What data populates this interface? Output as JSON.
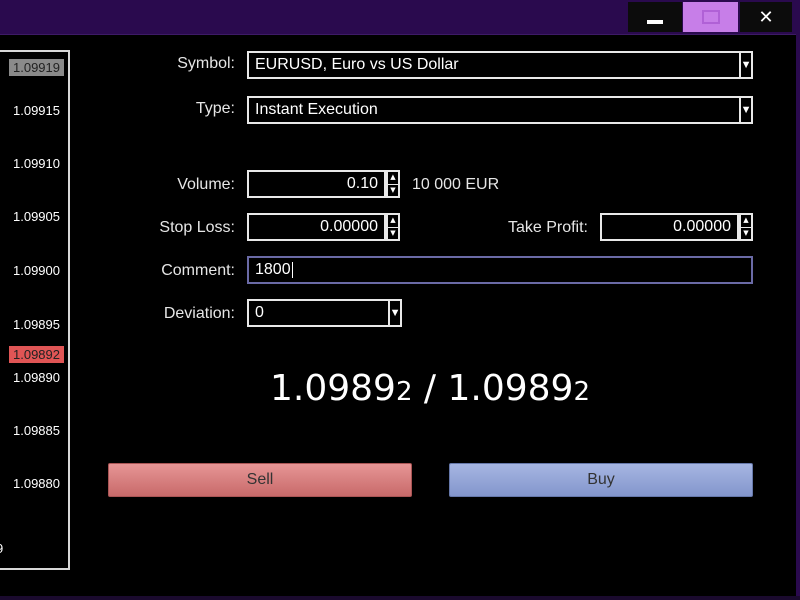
{
  "window": {
    "close_glyph": "✕",
    "min_icon": "minimize-icon",
    "max_icon": "maximize-icon"
  },
  "ticks": {
    "boxed_top": "1.09919",
    "levels": [
      "1.09915",
      "1.09910",
      "1.09905",
      "1.09900",
      "1.09895"
    ],
    "current": "1.09892",
    "lower": [
      "1.09890",
      "1.09885",
      "1.09880"
    ],
    "cut_off": "9"
  },
  "form": {
    "symbol_label": "Symbol:",
    "symbol_value": "EURUSD, Euro vs US Dollar",
    "type_label": "Type:",
    "type_value": "Instant Execution",
    "volume_label": "Volume:",
    "volume_value": "0.10",
    "volume_note": "10 000 EUR",
    "stoploss_label": "Stop Loss:",
    "stoploss_value": "0.00000",
    "takeprofit_label": "Take Profit:",
    "takeprofit_value": "0.00000",
    "comment_label": "Comment:",
    "comment_value": "1800",
    "deviation_label": "Deviation:",
    "deviation_value": "0"
  },
  "quote": {
    "bid_main": "1.0989",
    "bid_small": "2",
    "separator": " / ",
    "ask_main": "1.0989",
    "ask_small": "2"
  },
  "buttons": {
    "sell": "Sell",
    "buy": "Buy"
  },
  "colors": {
    "title": "#2a0a4e",
    "sell": "#d98080",
    "buy": "#94a6d8",
    "current_tick": "#e05555"
  }
}
